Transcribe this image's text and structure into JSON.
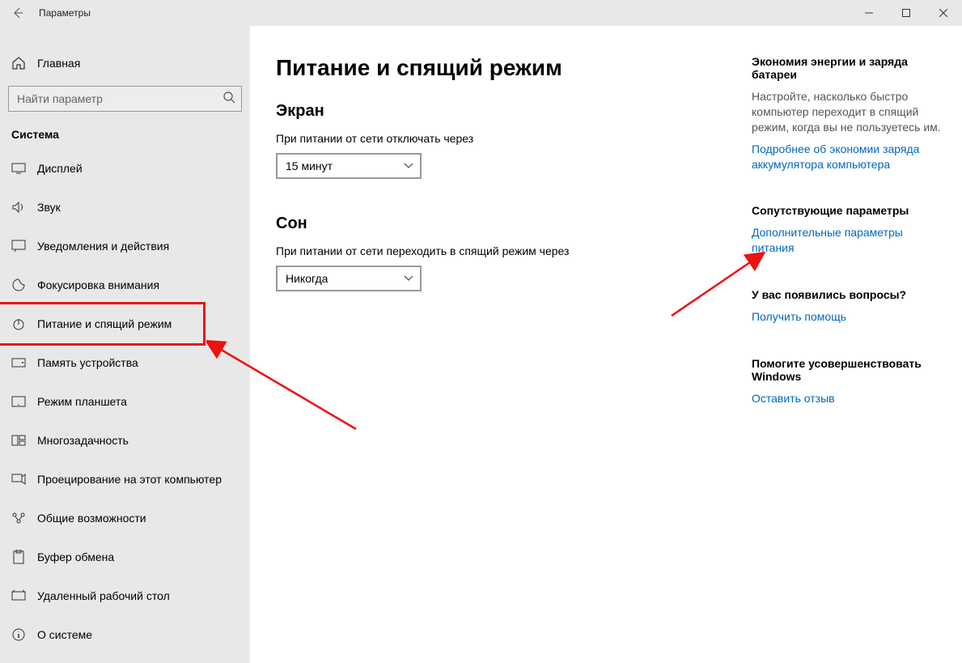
{
  "titlebar": {
    "title": "Параметры"
  },
  "sidebar": {
    "home": "Главная",
    "search_placeholder": "Найти параметр",
    "category": "Система",
    "items": [
      {
        "label": "Дисплей"
      },
      {
        "label": "Звук"
      },
      {
        "label": "Уведомления и действия"
      },
      {
        "label": "Фокусировка внимания"
      },
      {
        "label": "Питание и спящий режим"
      },
      {
        "label": "Память устройства"
      },
      {
        "label": "Режим планшета"
      },
      {
        "label": "Многозадачность"
      },
      {
        "label": "Проецирование на этот компьютер"
      },
      {
        "label": "Общие возможности"
      },
      {
        "label": "Буфер обмена"
      },
      {
        "label": "Удаленный рабочий стол"
      },
      {
        "label": "О системе"
      }
    ]
  },
  "content": {
    "page_title": "Питание и спящий режим",
    "screen_section": "Экран",
    "screen_off_label": "При питании от сети отключать через",
    "screen_off_value": "15 минут",
    "sleep_section": "Сон",
    "sleep_label": "При питании от сети переходить в спящий режим через",
    "sleep_value": "Никогда"
  },
  "aside": {
    "energy_title": "Экономия энергии и заряда батареи",
    "energy_text": "Настройте, насколько быстро компьютер переходит в спящий режим, когда вы не пользуетесь им.",
    "energy_link": "Подробнее об экономии заряда аккумулятора компьютера",
    "related_title": "Сопутствующие параметры",
    "related_link": "Дополнительные параметры питания",
    "questions_title": "У вас появились вопросы?",
    "questions_link": "Получить помощь",
    "improve_title": "Помогите усовершенствовать Windows",
    "improve_link": "Оставить отзыв"
  }
}
